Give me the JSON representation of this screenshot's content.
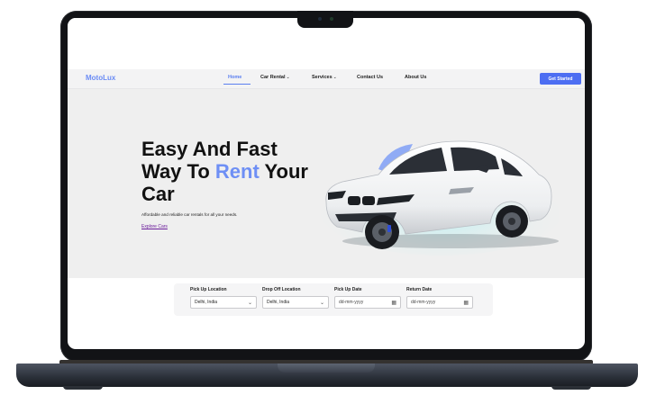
{
  "brand": {
    "name": "MotoLux",
    "accent_color": "#6e8ff5",
    "button_color": "#4d6ef2"
  },
  "nav": {
    "items": [
      {
        "label": "Home",
        "active": true
      },
      {
        "label": "Car Rental",
        "has_dropdown": true
      },
      {
        "label": "Services",
        "has_dropdown": true
      },
      {
        "label": "Contact Us"
      },
      {
        "label": "About Us"
      }
    ],
    "cta_label": "Get Started"
  },
  "hero": {
    "title_line1": "Easy And Fast",
    "title_line2_pre": "Way To ",
    "title_line2_accent": "Rent",
    "title_line2_post": " Your",
    "title_line3": "Car",
    "subtitle": "Affordable and reliable car rentals for all your needs.",
    "link_label": "Explore Cars",
    "image": "white-sports-car"
  },
  "booking": {
    "pickup_location": {
      "label": "Pick Up Location",
      "value": "Delhi, India",
      "icon": "chevron-down-icon"
    },
    "dropoff_location": {
      "label": "Drop Off Location",
      "value": "Delhi, India",
      "icon": "chevron-down-icon"
    },
    "pickup_date": {
      "label": "Pick Up Date",
      "placeholder": "dd-mm-yyyy",
      "icon": "calendar-icon"
    },
    "return_date": {
      "label": "Return Date",
      "placeholder": "dd-mm-yyyy",
      "icon": "calendar-icon"
    }
  }
}
